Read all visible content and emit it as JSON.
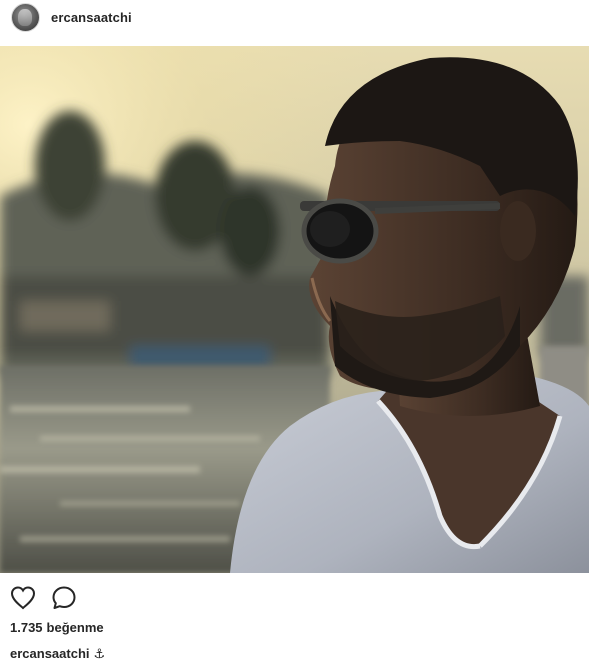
{
  "post": {
    "username": "ercansaatchi",
    "likes_count": "1.735",
    "likes_label": "beğenme",
    "caption_user": "ercansaatchi",
    "caption_text": "⚓"
  },
  "icons": {
    "like": "heart-outline-icon",
    "comment": "comment-bubble-icon"
  },
  "colors": {
    "text": "#262626",
    "border": "#dbdbdb",
    "background": "#ffffff"
  }
}
